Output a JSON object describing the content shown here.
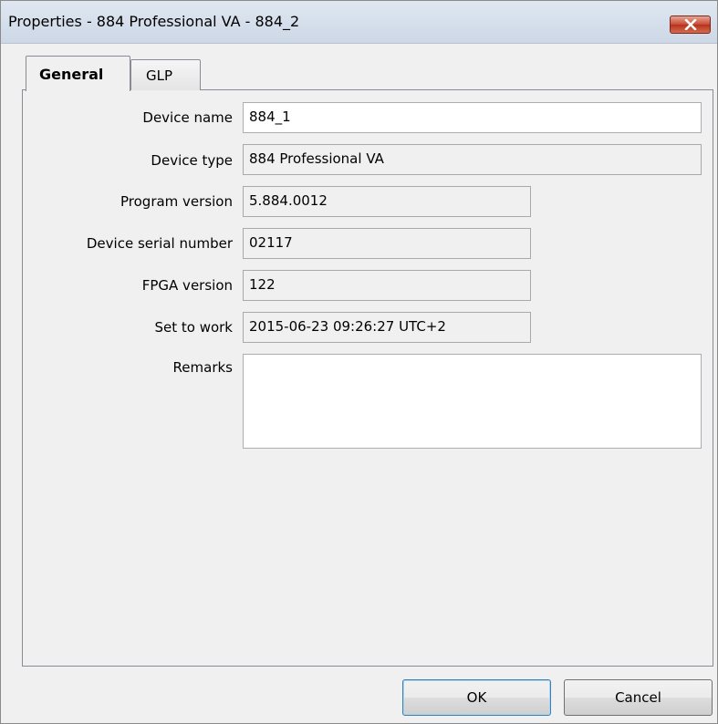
{
  "window": {
    "title": "Properties - 884 Professional VA - 884_2",
    "close_icon": "close-icon"
  },
  "tabs": [
    {
      "label": "General",
      "selected": true
    },
    {
      "label": "GLP",
      "selected": false
    }
  ],
  "fields": {
    "device_name": {
      "label": "Device name",
      "value": "884_1"
    },
    "device_type": {
      "label": "Device type",
      "value": "884 Professional VA"
    },
    "program_version": {
      "label": "Program version",
      "value": "5.884.0012"
    },
    "serial_number": {
      "label": "Device serial number",
      "value": "02117"
    },
    "fpga_version": {
      "label": "FPGA version",
      "value": "122"
    },
    "set_to_work": {
      "label": "Set to work",
      "value": "2015-06-23 09:26:27 UTC+2"
    },
    "remarks": {
      "label": "Remarks",
      "value": ""
    }
  },
  "buttons": {
    "ok": "OK",
    "cancel": "Cancel"
  },
  "colors": {
    "close_button": "#c74a32",
    "title_bar": "#d6dfea",
    "dialog_bg": "#f0f0f0"
  }
}
